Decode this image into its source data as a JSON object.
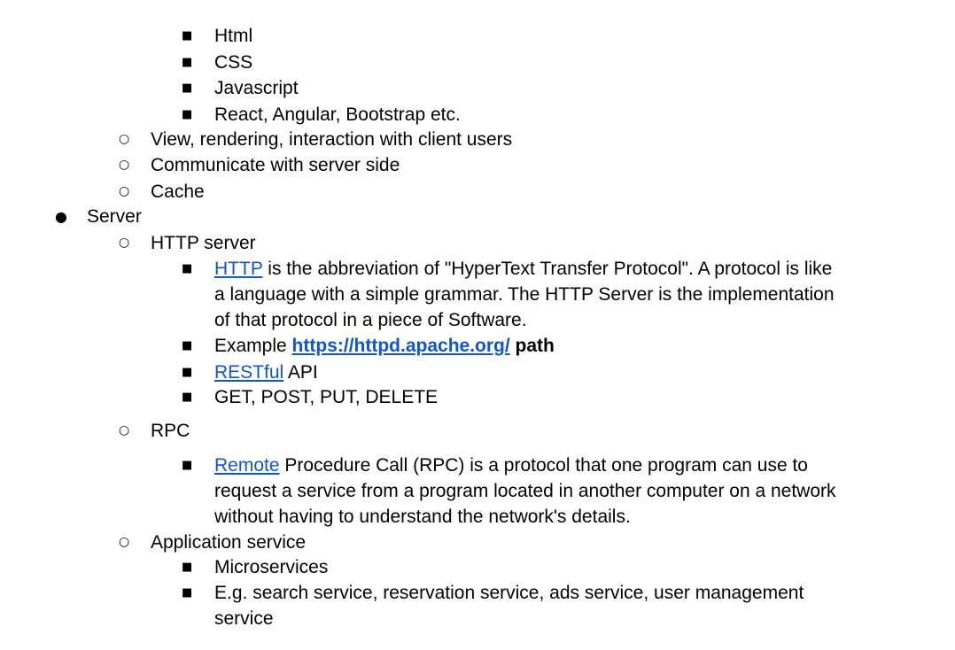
{
  "bullets": {
    "square": "■",
    "circle": "○",
    "disc": "●"
  },
  "items": {
    "html": "Html",
    "css": "CSS",
    "javascript": "Javascript",
    "frameworks": "React, Angular, Bootstrap etc.",
    "view": "View, rendering, interaction with client users",
    "communicate": "Communicate with server side",
    "cache": "Cache",
    "server": "Server",
    "http_server": "HTTP server",
    "http_link": "HTTP",
    "http_desc": " is the abbreviation of \"HyperText Transfer Protocol\". A protocol is like a language with a simple grammar. The HTTP Server is the implementation of that protocol in a piece of Software.",
    "example_label": "Example ",
    "example_link": "https://httpd.apache.org/",
    "example_suffix": " path",
    "restful_link": "RESTful",
    "restful_suffix": " API",
    "methods": "GET, POST, PUT, DELETE",
    "rpc": "RPC",
    "remote_link": "Remote",
    "rpc_desc": " Procedure Call (RPC) is a protocol that one program can use to request a service from a program located in another computer on a network without having to understand the network's details.",
    "app_service": "Application service",
    "microservices": "Microservices",
    "eg_services": "E.g. search service, reservation service, ads service, user management service"
  },
  "colors": {
    "link": "#1155cc",
    "text": "#000000"
  }
}
